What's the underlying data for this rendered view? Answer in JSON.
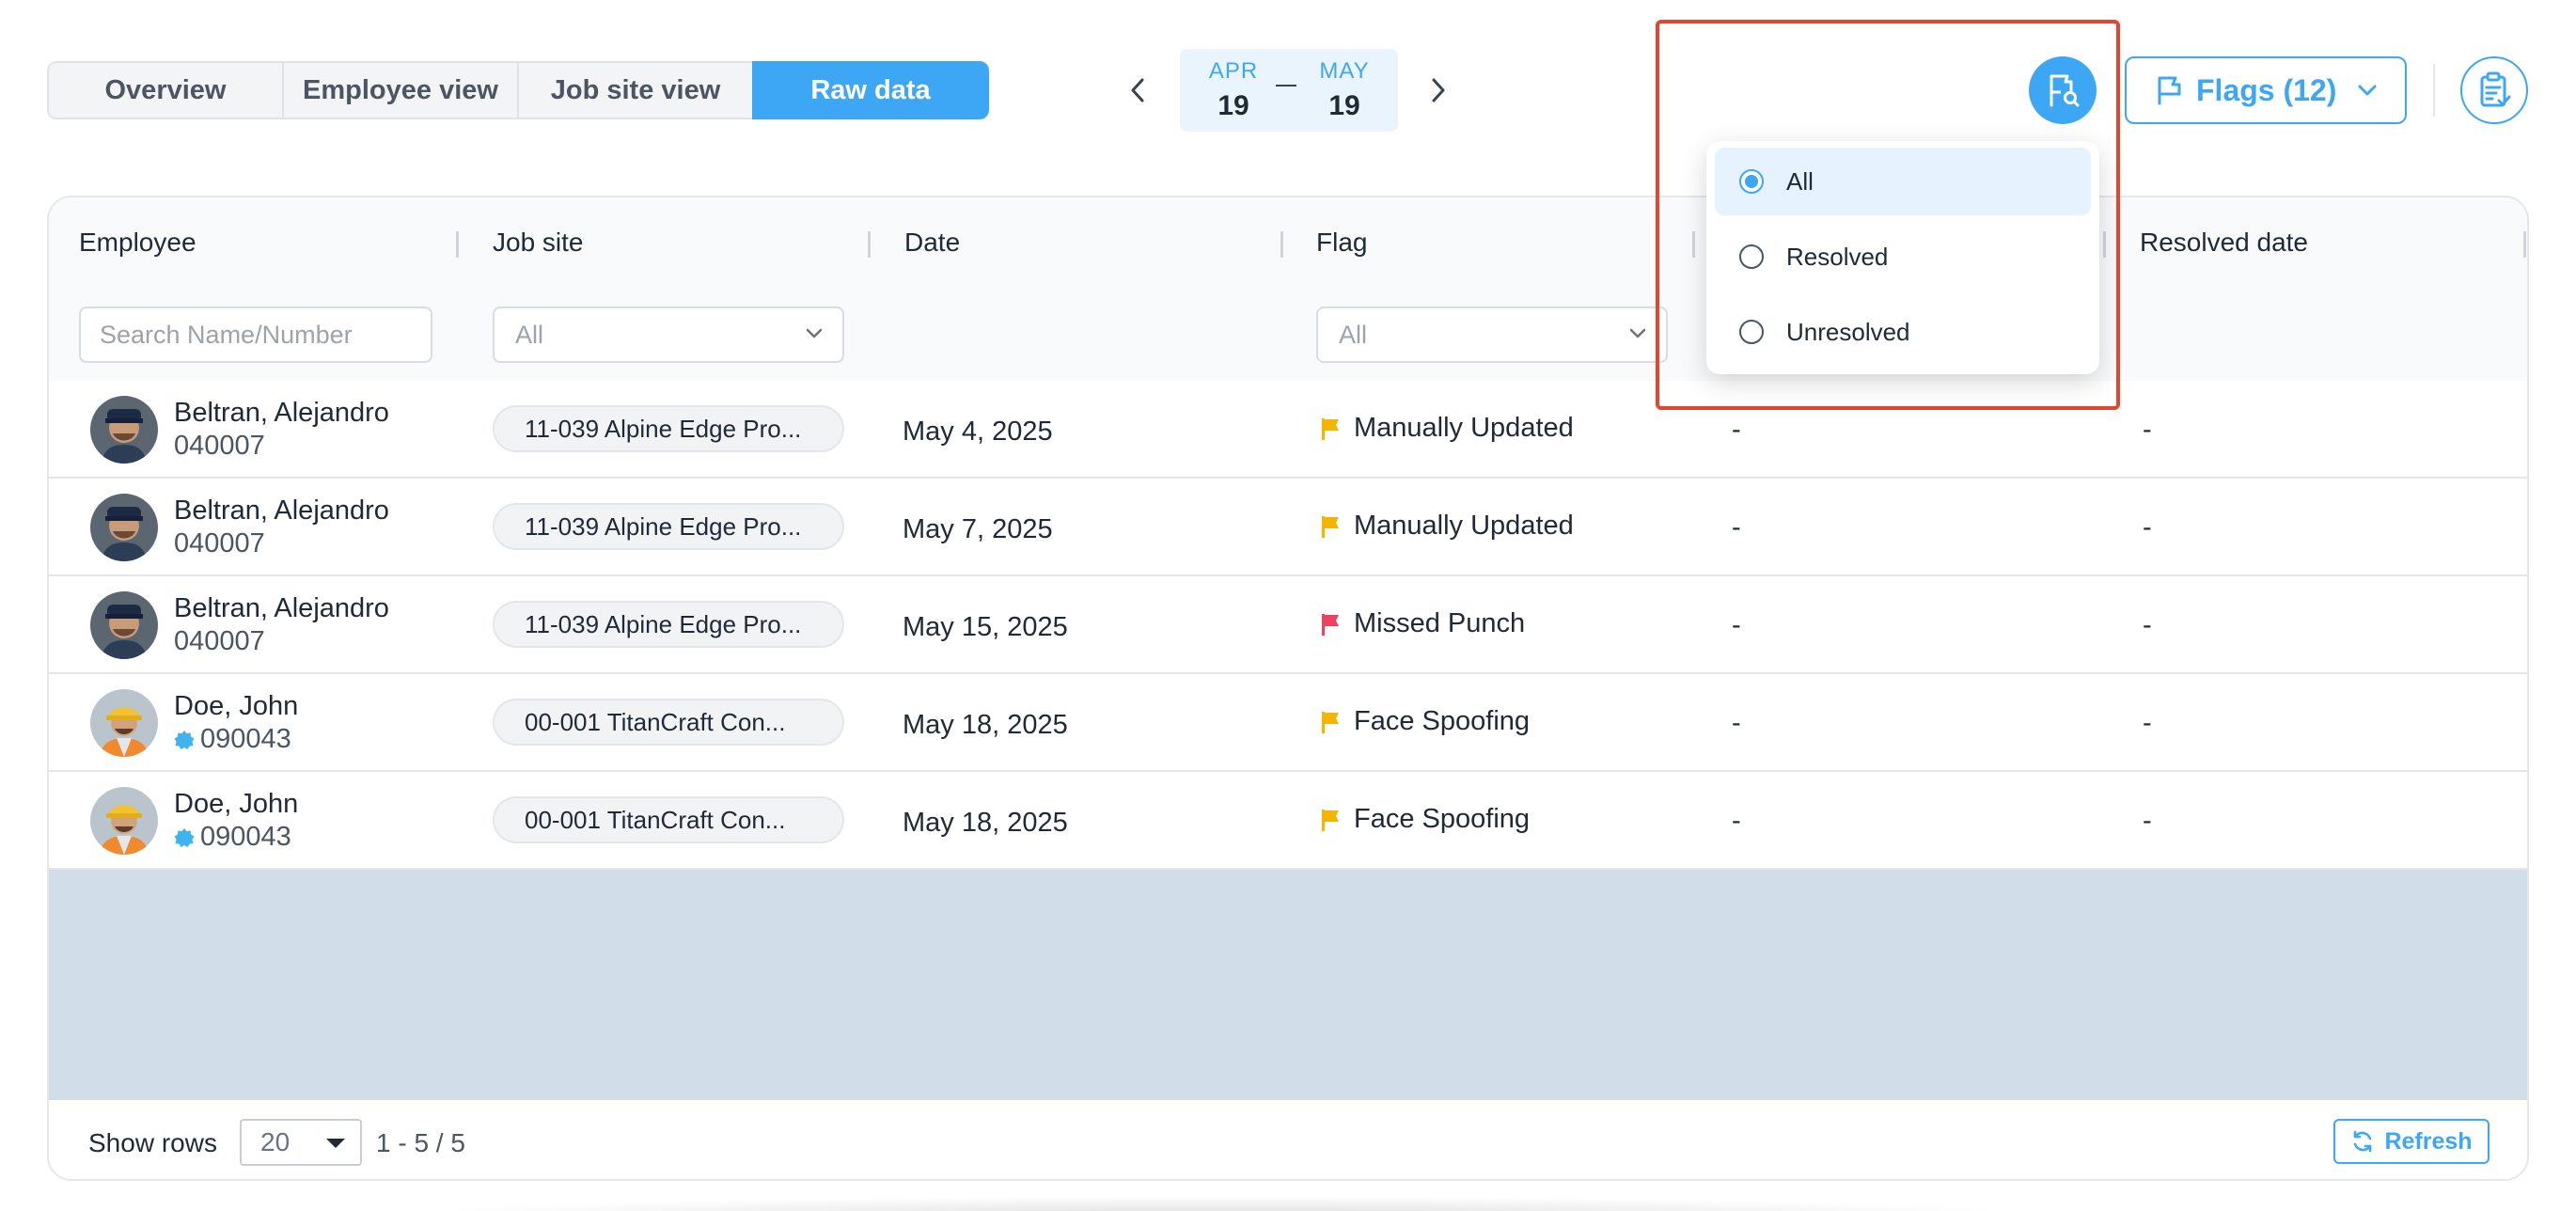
{
  "tabs": [
    {
      "label": "Overview",
      "active": false
    },
    {
      "label": "Employee view",
      "active": false
    },
    {
      "label": "Job site view",
      "active": false
    },
    {
      "label": "Raw data",
      "active": true
    }
  ],
  "date_range": {
    "start": {
      "month": "APR",
      "day": "19"
    },
    "end": {
      "month": "MAY",
      "day": "19"
    }
  },
  "toolbar": {
    "flags_label": "Flags (12)"
  },
  "columns": {
    "employee": "Employee",
    "job_site": "Job site",
    "date": "Date",
    "flag": "Flag",
    "resolved_date": "Resolved date"
  },
  "filters": {
    "search_placeholder": "Search Name/Number",
    "job_site_value": "All",
    "flag_value": "All"
  },
  "dropdown": {
    "options": [
      {
        "label": "All",
        "selected": true
      },
      {
        "label": "Resolved",
        "selected": false
      },
      {
        "label": "Unresolved",
        "selected": false
      }
    ]
  },
  "rows": [
    {
      "name": "Beltran, Alejandro",
      "number": "040007",
      "verified": false,
      "site": "11-039 Alpine Edge Pro...",
      "date": "May 4, 2025",
      "flag": "Manually Updated",
      "flag_color": "#f5b400",
      "resolved": "-",
      "resolved_date": "-"
    },
    {
      "name": "Beltran, Alejandro",
      "number": "040007",
      "verified": false,
      "site": "11-039 Alpine Edge Pro...",
      "date": "May 7, 2025",
      "flag": "Manually Updated",
      "flag_color": "#f5b400",
      "resolved": "-",
      "resolved_date": "-"
    },
    {
      "name": "Beltran, Alejandro",
      "number": "040007",
      "verified": false,
      "site": "11-039 Alpine Edge Pro...",
      "date": "May 15, 2025",
      "flag": "Missed Punch",
      "flag_color": "#ef4160",
      "resolved": "-",
      "resolved_date": "-"
    },
    {
      "name": "Doe, John",
      "number": "090043",
      "verified": true,
      "site": "00-001 TitanCraft Con...",
      "date": "May 18, 2025",
      "flag": "Face Spoofing",
      "flag_color": "#f5b400",
      "resolved": "-",
      "resolved_date": "-"
    },
    {
      "name": "Doe, John",
      "number": "090043",
      "verified": true,
      "site": "00-001 TitanCraft Con...",
      "date": "May 18, 2025",
      "flag": "Face Spoofing",
      "flag_color": "#f5b400",
      "resolved": "-",
      "resolved_date": "-"
    }
  ],
  "footer": {
    "show_rows_label": "Show rows",
    "rows_per_page": "20",
    "range": "1 - 5 / 5",
    "refresh_label": "Refresh"
  }
}
